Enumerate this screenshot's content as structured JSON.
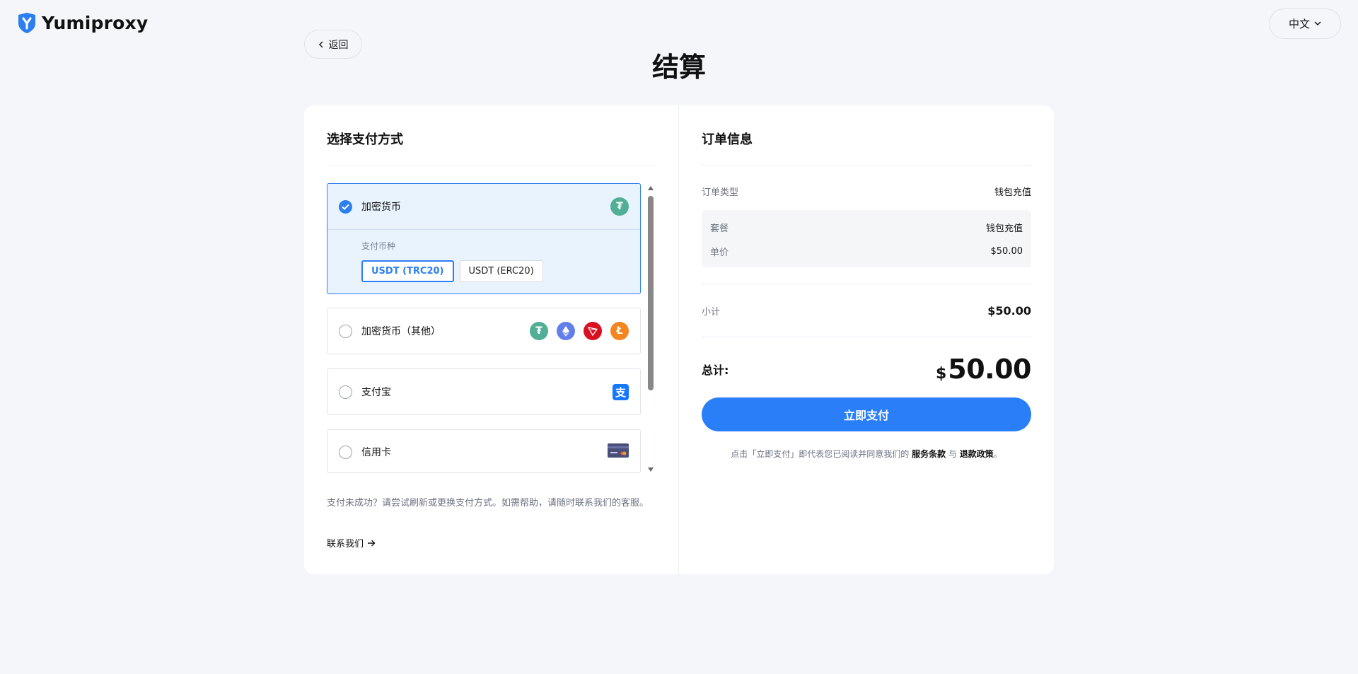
{
  "brand": {
    "name": "Yumiproxy",
    "color": "#2d7ff0"
  },
  "language": {
    "label": "中文"
  },
  "back": {
    "label": "返回"
  },
  "page": {
    "title": "结算"
  },
  "payment": {
    "title": "选择支付方式",
    "options": [
      {
        "label": "加密货币",
        "selected": true,
        "icons": [
          "tether-icon"
        ]
      },
      {
        "label": "加密货币（其他）",
        "selected": false,
        "icons": [
          "tether-icon",
          "ethereum-icon",
          "tron-icon",
          "litecoin-icon"
        ]
      },
      {
        "label": "支付宝",
        "selected": false,
        "icons": [
          "alipay-icon"
        ]
      },
      {
        "label": "信用卡",
        "selected": false,
        "icons": [
          "credit-card-icon"
        ]
      }
    ],
    "currency_label": "支付币种",
    "currencies": [
      {
        "label": "USDT (TRC20)",
        "active": true
      },
      {
        "label": "USDT (ERC20)",
        "active": false
      }
    ],
    "help_text": "支付未成功？请尝试刷新或更换支付方式。如需帮助，请随时联系我们的客服。",
    "contact_label": "联系我们"
  },
  "order": {
    "title": "订单信息",
    "type_key": "订单类型",
    "type_value": "钱包充值",
    "package_key": "套餐",
    "package_value": "钱包充值",
    "unit_price_key": "单价",
    "unit_price_value": "$50.00",
    "subtotal_key": "小计",
    "subtotal_value": "$50.00",
    "total_key": "总计:",
    "total_currency": "$",
    "total_amount": "50.00",
    "pay_button": "立即支付",
    "terms_prefix": "点击「立即支付」即代表您已阅读并同意我们的",
    "terms_service": "服务条款",
    "terms_and": "与",
    "terms_refund": "退款政策",
    "terms_suffix": "。"
  },
  "colors": {
    "accent": "#2a7ff8",
    "tether": "#50af95",
    "ethereum": "#627eea",
    "tron": "#d9101f",
    "litecoin": "#f4851f",
    "alipay": "#1677ff"
  }
}
